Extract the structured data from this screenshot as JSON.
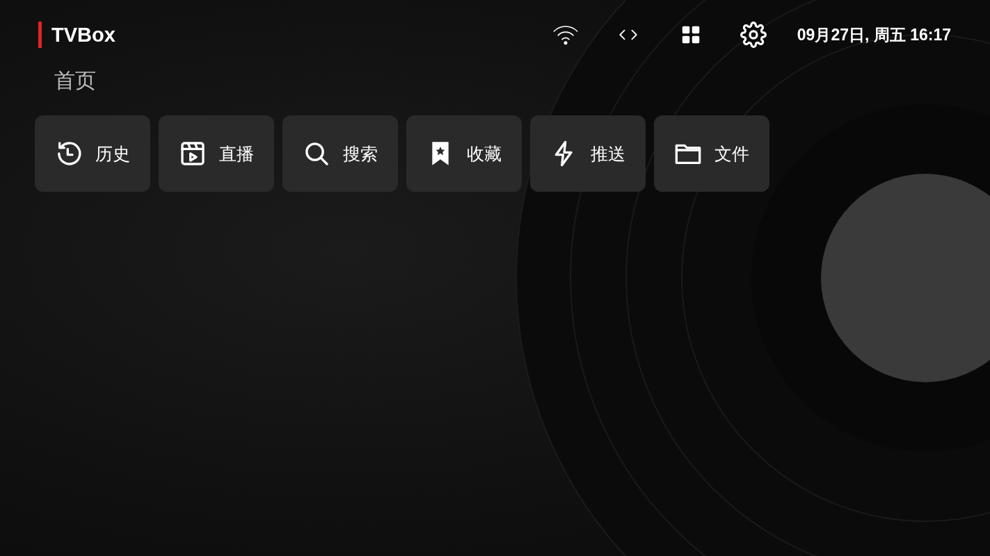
{
  "app": {
    "title": "TVBox"
  },
  "status_icons": [
    {
      "kind": "wifi"
    },
    {
      "kind": "code"
    },
    {
      "kind": "apps"
    },
    {
      "kind": "settings"
    }
  ],
  "datetime": "09月27日, 周五 16:17",
  "section": {
    "title": "首页"
  },
  "shortcuts": [
    {
      "kind": "history",
      "label": "历史"
    },
    {
      "kind": "live",
      "label": "直播"
    },
    {
      "kind": "search",
      "label": "搜索"
    },
    {
      "kind": "bookmark",
      "label": "收藏"
    },
    {
      "kind": "push",
      "label": "推送"
    },
    {
      "kind": "folder",
      "label": "文件"
    }
  ]
}
